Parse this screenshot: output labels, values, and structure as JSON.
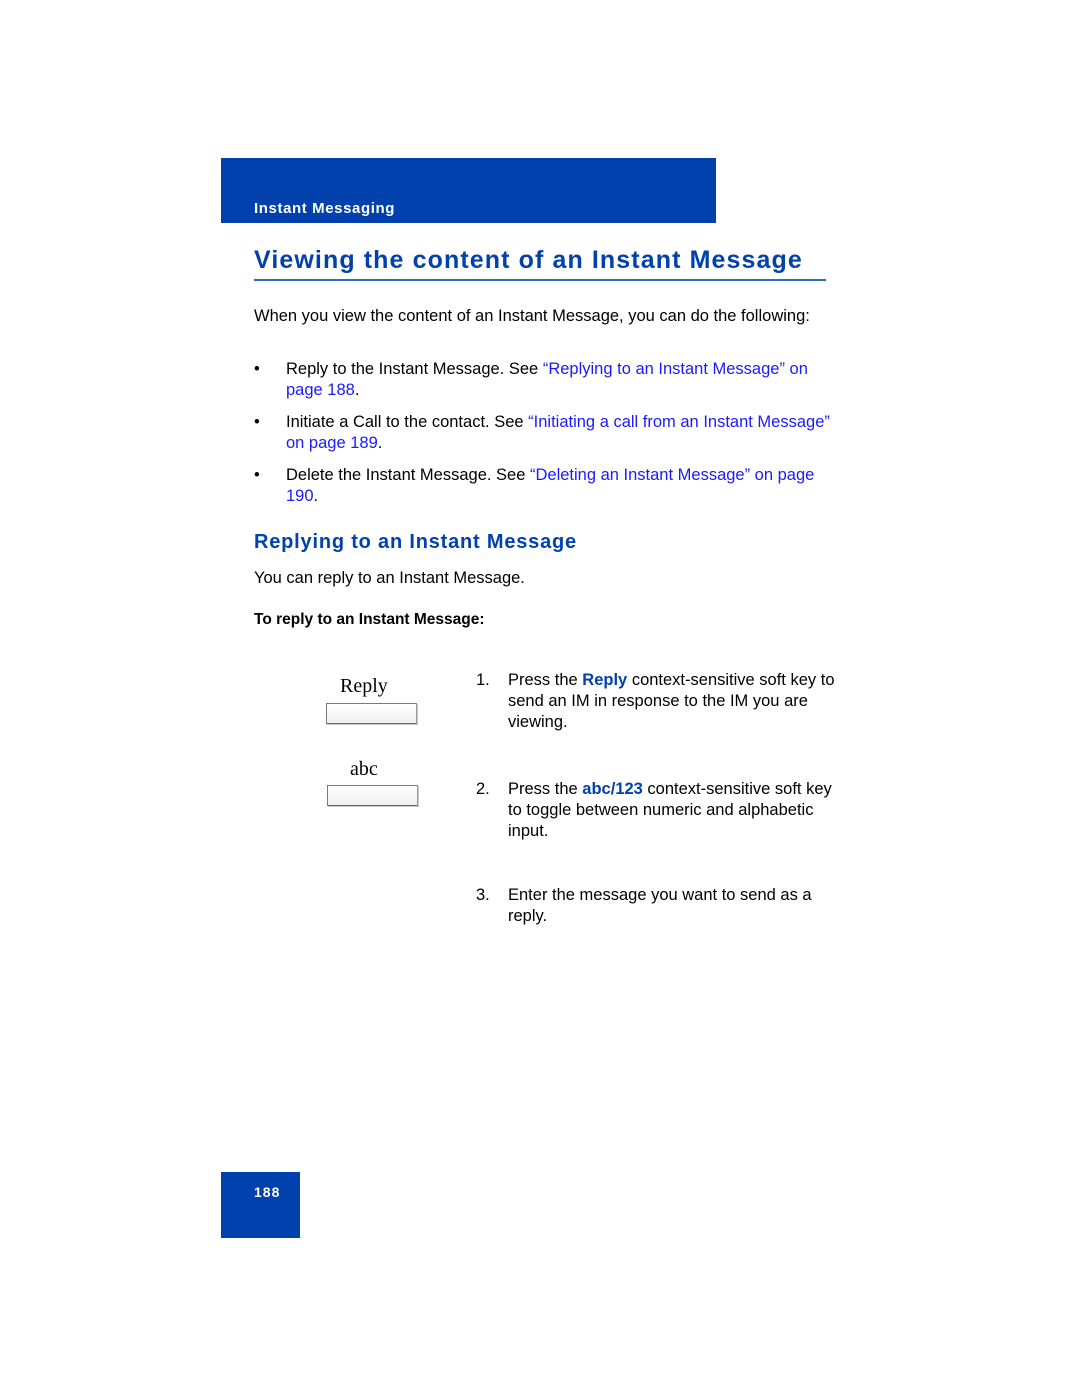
{
  "header": {
    "section_label": "Instant Messaging"
  },
  "page_title": "Viewing the content of an Instant Message",
  "intro": "When you view the content of an Instant Message, you can do the following:",
  "bullets": [
    {
      "bullet_char": "•",
      "text": "Reply to the Instant Message. See ",
      "link": "“Replying to an Instant Message” on page 188",
      "trail": "."
    },
    {
      "bullet_char": "•",
      "text": "Initiate a Call to the contact. See ",
      "link": "“Initiating a call from an Instant Message” on page 189",
      "trail": "."
    },
    {
      "bullet_char": "•",
      "text": "Delete the Instant Message. See ",
      "link": "“Deleting an Instant Message” on page 190",
      "trail": "."
    }
  ],
  "section": {
    "title": "Replying to an Instant Message",
    "intro": "You can reply to an Instant Message.",
    "procedure_title": "To reply to an Instant Message:"
  },
  "softkeys": [
    {
      "label": "Reply"
    },
    {
      "label": "abc"
    }
  ],
  "steps": [
    {
      "number": "1.",
      "pre": "Press the ",
      "keyword": "Reply",
      "post": " context-sensitive soft key to send an IM in response to the IM you are viewing."
    },
    {
      "number": "2.",
      "pre": "Press the ",
      "keyword": "abc/123",
      "post": " context-sensitive soft key to toggle between numeric and alphabetic input."
    },
    {
      "number": "3.",
      "pre": "Enter the message you want to send as a reply.",
      "keyword": "",
      "post": ""
    }
  ],
  "footer": {
    "page_number": "188"
  },
  "colors": {
    "brand_blue": "#0041ad",
    "link_blue": "#1a1aff",
    "rule_blue": "#2b6cc4"
  }
}
